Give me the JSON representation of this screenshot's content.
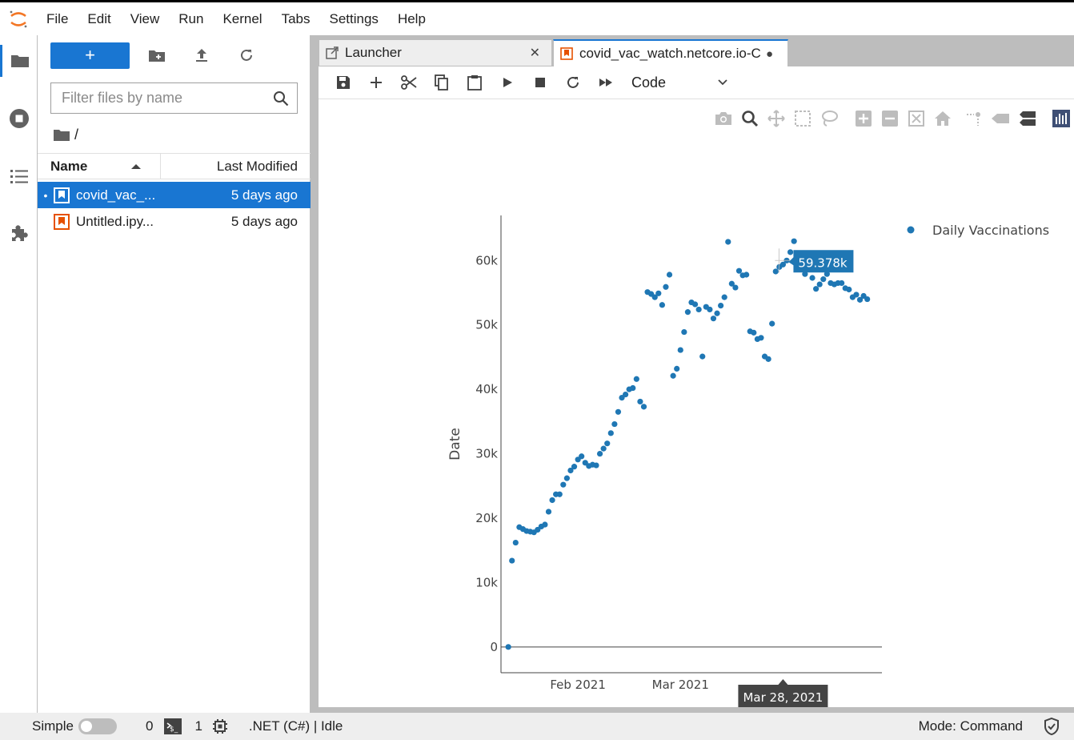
{
  "menu": [
    "File",
    "Edit",
    "View",
    "Run",
    "Kernel",
    "Tabs",
    "Settings",
    "Help"
  ],
  "filebrowser": {
    "new_label": "+",
    "filter_placeholder": "Filter files by name",
    "breadcrumb": "/",
    "col_name": "Name",
    "col_modified": "Last Modified",
    "files": [
      {
        "name": "covid_vac_...",
        "modified": "5 days ago",
        "selected": true,
        "dot": "•"
      },
      {
        "name": "Untitled.ipy...",
        "modified": "5 days ago",
        "selected": false,
        "dot": ""
      }
    ]
  },
  "tabs": [
    {
      "label": "Launcher",
      "close": "✕",
      "active": false
    },
    {
      "label": "covid_vac_watch.netcore.io-C",
      "close": "●",
      "active": true
    }
  ],
  "notebook": {
    "cell_type": "Code"
  },
  "colors": {
    "accent": "#1976d2",
    "marker": "#1f77b4",
    "notebook_icon": "#e65100"
  },
  "chart_data": {
    "type": "scatter",
    "ylabel": "Date",
    "legend": {
      "label": "Daily Vaccinations",
      "placement": "top-right"
    },
    "x_ticks": [
      "Feb 2021",
      "Mar 2021"
    ],
    "y_ticks": [
      "0",
      "10k",
      "20k",
      "30k",
      "40k",
      "50k",
      "60k"
    ],
    "ylim": [
      -4000,
      67000
    ],
    "xlim": [
      "2021-01-11",
      "2021-04-25"
    ],
    "hover": {
      "x_label": "Mar 28, 2021",
      "y_label": "59.378k"
    },
    "series": [
      {
        "name": "Daily Vaccinations",
        "x": [
          "2021-01-13",
          "2021-01-14",
          "2021-01-15",
          "2021-01-16",
          "2021-01-17",
          "2021-01-18",
          "2021-01-19",
          "2021-01-20",
          "2021-01-21",
          "2021-01-22",
          "2021-01-23",
          "2021-01-24",
          "2021-01-25",
          "2021-01-26",
          "2021-01-27",
          "2021-01-28",
          "2021-01-29",
          "2021-01-30",
          "2021-01-31",
          "2021-02-01",
          "2021-02-02",
          "2021-02-03",
          "2021-02-04",
          "2021-02-05",
          "2021-02-06",
          "2021-02-07",
          "2021-02-08",
          "2021-02-09",
          "2021-02-10",
          "2021-02-11",
          "2021-02-12",
          "2021-02-13",
          "2021-02-14",
          "2021-02-15",
          "2021-02-16",
          "2021-02-17",
          "2021-02-18",
          "2021-02-19",
          "2021-02-20",
          "2021-02-21",
          "2021-02-22",
          "2021-02-23",
          "2021-02-24",
          "2021-02-25",
          "2021-02-26",
          "2021-02-27",
          "2021-02-28",
          "2021-03-01",
          "2021-03-02",
          "2021-03-03",
          "2021-03-04",
          "2021-03-05",
          "2021-03-06",
          "2021-03-07",
          "2021-03-08",
          "2021-03-09",
          "2021-03-10",
          "2021-03-11",
          "2021-03-12",
          "2021-03-13",
          "2021-03-14",
          "2021-03-15",
          "2021-03-16",
          "2021-03-17",
          "2021-03-18",
          "2021-03-19",
          "2021-03-20",
          "2021-03-21",
          "2021-03-22",
          "2021-03-23",
          "2021-03-24",
          "2021-03-25",
          "2021-03-26",
          "2021-03-27",
          "2021-03-28",
          "2021-03-29",
          "2021-03-30",
          "2021-03-31",
          "2021-04-01",
          "2021-04-02",
          "2021-04-03",
          "2021-04-04",
          "2021-04-05",
          "2021-04-06",
          "2021-04-07",
          "2021-04-08",
          "2021-04-09",
          "2021-04-10",
          "2021-04-11",
          "2021-04-12",
          "2021-04-13",
          "2021-04-14",
          "2021-04-15",
          "2021-04-16",
          "2021-04-17",
          "2021-04-18",
          "2021-04-19",
          "2021-04-20",
          "2021-04-21"
        ],
        "y": [
          0,
          13400,
          16200,
          18600,
          18300,
          18000,
          17900,
          17800,
          18200,
          18700,
          19000,
          21000,
          22800,
          23700,
          23700,
          25200,
          26200,
          27400,
          28000,
          29100,
          29600,
          28600,
          28100,
          28300,
          28200,
          30000,
          30800,
          31600,
          33200,
          34600,
          36500,
          38700,
          39200,
          40000,
          40200,
          41600,
          38100,
          37300,
          55100,
          54800,
          54300,
          54900,
          53100,
          55900,
          57800,
          42100,
          43200,
          46100,
          48900,
          52000,
          53500,
          53200,
          52400,
          45100,
          52800,
          52400,
          51000,
          51800,
          53000,
          54300,
          62900,
          56400,
          55800,
          58400,
          57700,
          57800,
          49000,
          48800,
          47800,
          48000,
          45100,
          44700,
          50200,
          58300,
          59000,
          59378,
          60000,
          61300,
          63000,
          59600,
          58900,
          57900,
          58900,
          57300,
          55600,
          56300,
          57100,
          57900,
          56500,
          56300,
          56500,
          56500,
          55700,
          55500,
          54300,
          54700,
          53900,
          54500,
          54000
        ],
        "tooltip_point_index": 75
      }
    ]
  }
}
